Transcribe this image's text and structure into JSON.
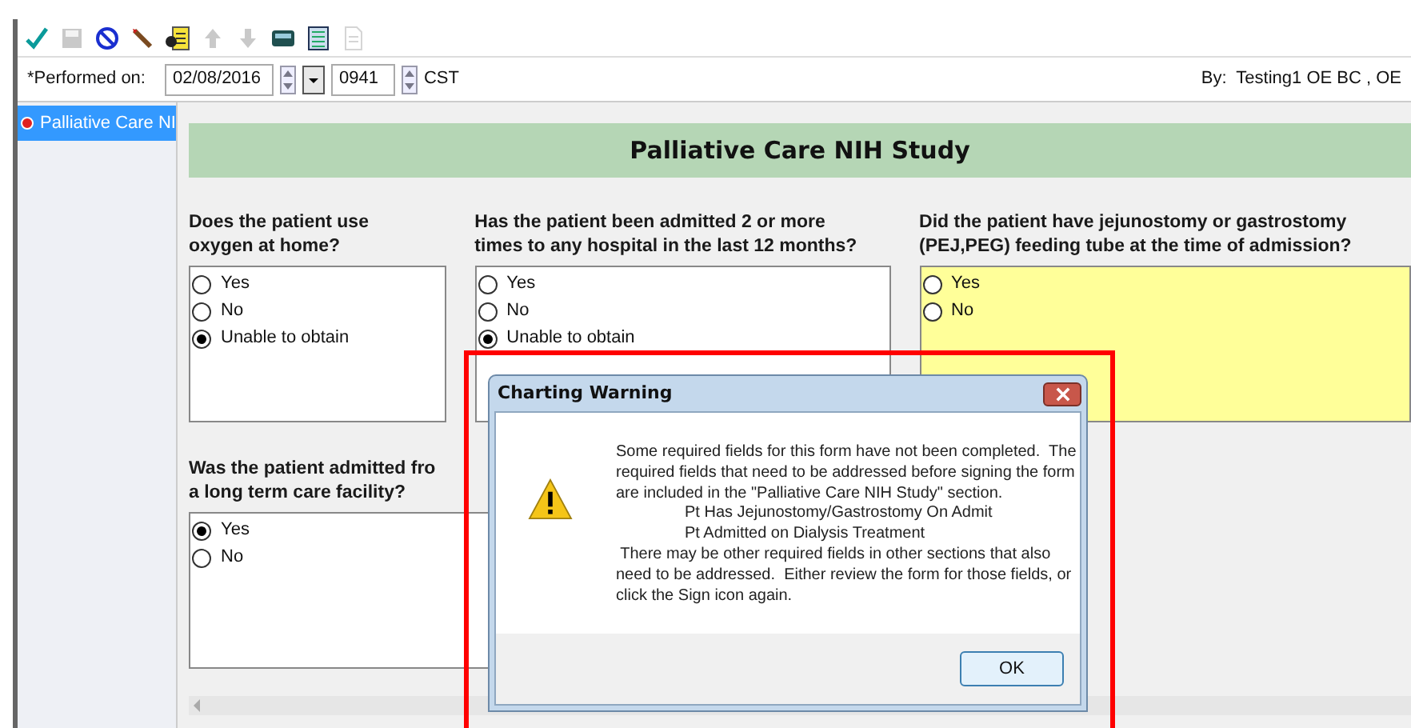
{
  "toolbar": {
    "items": [
      {
        "kind": "check",
        "disabled": false
      },
      {
        "kind": "save",
        "disabled": true
      },
      {
        "kind": "cancel",
        "disabled": false
      },
      {
        "kind": "wand",
        "disabled": false
      },
      {
        "kind": "form",
        "disabled": false
      },
      {
        "kind": "up",
        "disabled": true
      },
      {
        "kind": "down",
        "disabled": true
      },
      {
        "kind": "calculator",
        "disabled": false
      },
      {
        "kind": "checklist",
        "disabled": false
      },
      {
        "kind": "document",
        "disabled": true
      }
    ]
  },
  "performed": {
    "label": "*Performed on:",
    "date": "02/08/2016",
    "time": "0941",
    "timezone": "CST",
    "by": "By:  Testing1 OE BC , OE"
  },
  "sidebar": {
    "items": [
      {
        "label": "Palliative Care NI",
        "selected": true
      }
    ]
  },
  "section": {
    "title": "Palliative Care NIH Study"
  },
  "questions": [
    {
      "lines": [
        "Does the patient use",
        "oxygen at home?"
      ],
      "required": false,
      "options": [
        {
          "label": "Yes",
          "selected": false
        },
        {
          "label": "No",
          "selected": false
        },
        {
          "label": "Unable to obtain",
          "selected": true
        }
      ]
    },
    {
      "lines": [
        "Has the patient been admitted 2 or more",
        "times to any hospital in the last 12 months?"
      ],
      "required": false,
      "options": [
        {
          "label": "Yes",
          "selected": false
        },
        {
          "label": "No",
          "selected": false
        },
        {
          "label": "Unable to obtain",
          "selected": true
        }
      ]
    },
    {
      "lines": [
        "Did the patient have jejunostomy or gastrostomy",
        "(PEJ,PEG) feeding tube at the time of admission?"
      ],
      "required": true,
      "options": [
        {
          "label": "Yes",
          "selected": false
        },
        {
          "label": "No",
          "selected": false
        }
      ]
    },
    {
      "lines": [
        "Was the patient admitted fro",
        "a long term care facility?"
      ],
      "required": false,
      "options": [
        {
          "label": "Yes",
          "selected": true
        },
        {
          "label": "No",
          "selected": false
        }
      ]
    }
  ],
  "dialog": {
    "title": "Charting Warning",
    "message": [
      {
        "kind": "text",
        "text": "Some required fields for this form have not been completed.  The"
      },
      {
        "kind": "text",
        "text": "required fields that need to be addressed before signing the form"
      },
      {
        "kind": "text",
        "text": "are included in the \"Palliative Care NIH Study\" section."
      },
      {
        "kind": "item",
        "text": "Pt Has Jejunostomy/Gastrostomy On Admit"
      },
      {
        "kind": "item",
        "text": "Pt Admitted on Dialysis Treatment"
      },
      {
        "kind": "text",
        "text": " There may be other required fields in other sections that also"
      },
      {
        "kind": "text",
        "text": "need to be addressed.  Either review the form for those fields, or"
      },
      {
        "kind": "text",
        "text": "click the Sign icon again."
      }
    ],
    "button": "OK"
  }
}
